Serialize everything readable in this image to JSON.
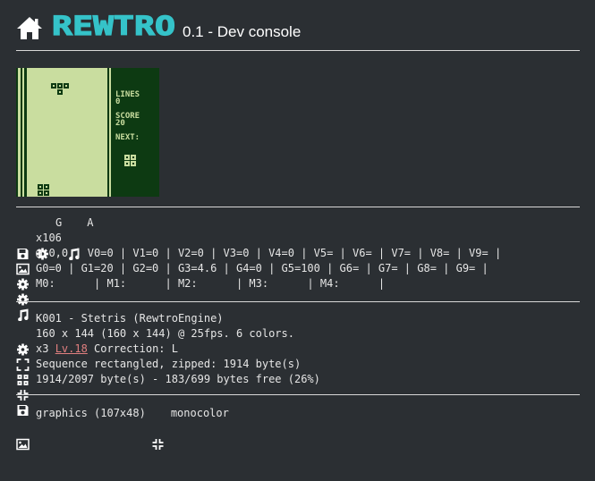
{
  "header": {
    "logo_text": "REWTRO",
    "version": "0.1 - Dev console"
  },
  "game_screen": {
    "lines_label": "LINES",
    "lines_value": "0",
    "score_label": "SCORE",
    "score_value": "20",
    "next_label": "NEXT:"
  },
  "status": {
    "graphics_mode": "G",
    "audio_mode": "A",
    "zoom": "x106",
    "vars_line": "@ 0,0 | V0=0 | V1=0 | V2=0 | V3=0 | V4=0 | V5= | V6= | V7= | V8= | V9= |",
    "globals_line": "G0=0 | G1=20 | G2=0 | G3=4.6 | G4=0 | G5=100 | G6= | G7= | G8= | G9= |",
    "music_line": "M0:      | M1:      | M2:      | M3:      | M4:      |"
  },
  "cart": {
    "title": "K001 - Stetris (RewtroEngine)",
    "resolution": "160 x 144 (160 x 144) @ 25fps. 6 colors.",
    "scale": "x3",
    "level_link": "Lv.18",
    "correction": "Correction: L",
    "sequence": "Sequence rectangled, zipped: 1914 byte(s)",
    "size": "1914/2097 byte(s) - 183/699 bytes free (26%)"
  },
  "footer": {
    "graphics": "graphics (107x48)",
    "mode": "monocolor"
  },
  "colors": {
    "background": "#2b2f33",
    "logo": "#35c3c9",
    "link": "#e07f7f",
    "gb_light": "#c9dd9f",
    "gb_dark": "#0d3a12"
  }
}
